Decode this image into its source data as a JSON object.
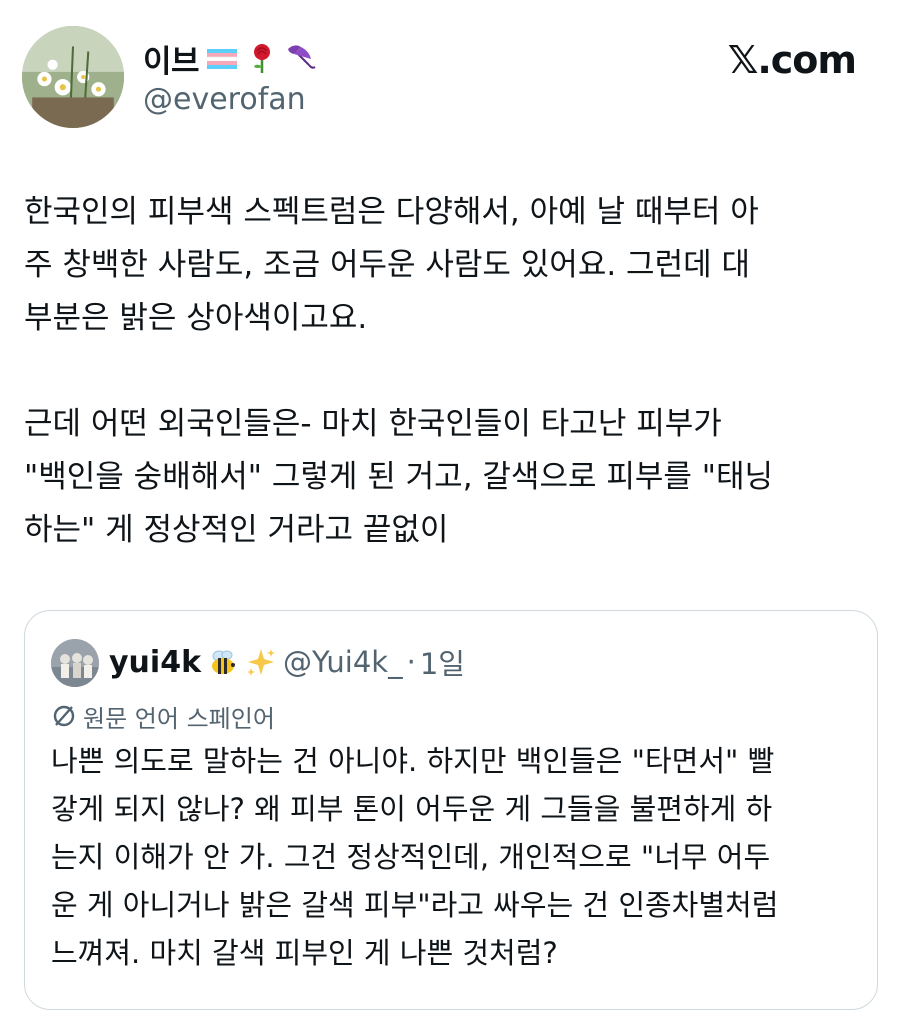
{
  "author": {
    "display_name": "이브",
    "handle": "@everofan",
    "avatar_icon": "flowers-avatar-icon",
    "name_emojis": [
      "transgender-flag-icon",
      "rose-icon",
      "umbrella-icon"
    ]
  },
  "brand": {
    "label": "𝕏.com"
  },
  "tweet": {
    "text": "한국인의 피부색 스펙트럼은 다양해서, 아예 날 때부터 아\n주 창백한 사람도, 조금 어두운 사람도 있어요. 그런데 대\n부분은 밝은 상아색이고요.\n\n근데 어떤 외국인들은- 마치 한국인들이 타고난 피부가\n\"백인을 숭배해서\" 그렇게 된 거고, 갈색으로 피부를 \"태닝\n하는\" 게 정상적인 거라고 끝없이"
  },
  "quoted": {
    "display_name": "yui4k",
    "name_emojis": [
      "bee-icon",
      "sparkles-icon"
    ],
    "handle": "@Yui4k_",
    "separator": "·",
    "time": "1일",
    "translation_label": "원문 언어 스페인어",
    "translation_icon": "translate-icon",
    "text": "나쁜 의도로 말하는 건 아니야. 하지만 백인들은 \"타면서\" 빨\n갛게 되지 않나? 왜 피부 톤이 어두운 게 그들을 불편하게 하\n는지 이해가 안 가. 그건 정상적인데, 개인적으로 \"너무 어두\n운 게 아니거나 밝은 갈색 피부\"라고 싸우는 건 인종차별처럼\n느껴져. 마치 갈색 피부인 게 나쁜 것처럼?"
  },
  "colors": {
    "text_primary": "#0f1419",
    "text_secondary": "#536471",
    "card_border": "#cfd9de"
  }
}
